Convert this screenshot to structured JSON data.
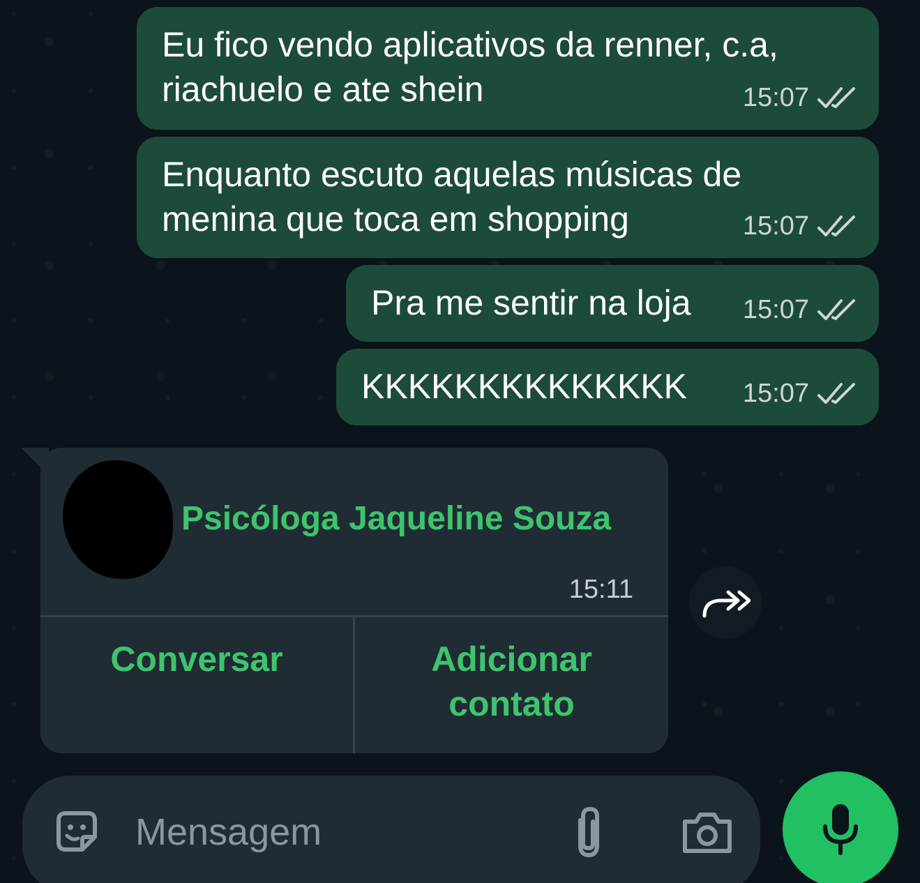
{
  "messages": [
    {
      "text_line1": "Eu fico vendo aplicativos da renner, c.a,",
      "text_line2": "riachuelo e ate shein",
      "time": "15:07"
    },
    {
      "text_line1": "Enquanto escuto aquelas músicas de",
      "text_line2": "menina que toca em shopping",
      "time": "15:07"
    },
    {
      "text": "Pra me sentir na loja",
      "time": "15:07"
    },
    {
      "text": "KKKKKKKKKKKKKK",
      "time": "15:07"
    }
  ],
  "contact_card": {
    "name": "Psicóloga Jaqueline Souza",
    "time": "15:11",
    "chat_button": "Conversar",
    "add_button_line1": "Adicionar",
    "add_button_line2": "contato"
  },
  "composer": {
    "placeholder": "Mensagem",
    "icons": [
      "sticker-icon",
      "attach-icon",
      "camera-icon",
      "mic-icon",
      "forward-icon"
    ]
  },
  "colors": {
    "outgoing_bubble": "#1d4b3a",
    "incoming_bubble": "#202c33",
    "accent_green": "#3ec46d",
    "mic_button": "#21c063",
    "background": "#0b141a"
  }
}
